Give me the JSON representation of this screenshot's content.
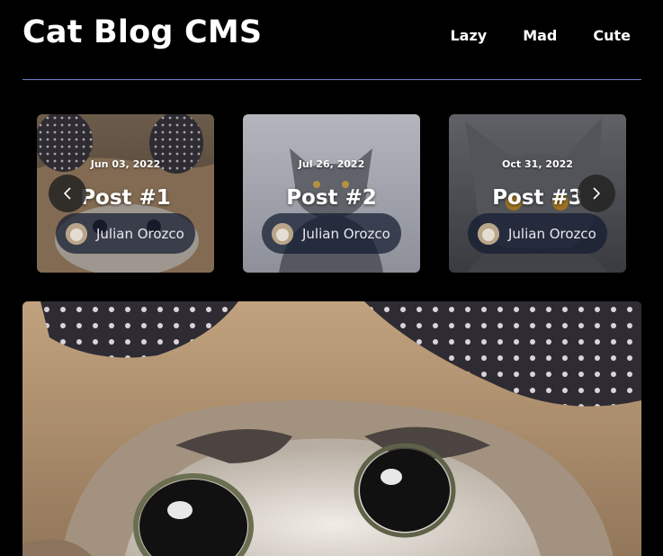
{
  "site": {
    "title": "Cat Blog CMS"
  },
  "nav": {
    "items": [
      {
        "label": "Lazy"
      },
      {
        "label": "Mad"
      },
      {
        "label": "Cute"
      }
    ]
  },
  "carousel": {
    "posts": [
      {
        "date": "Jun 03, 2022",
        "title": "Post #1",
        "author": "Julian Orozco"
      },
      {
        "date": "Jul 26, 2022",
        "title": "Post #2",
        "author": "Julian Orozco"
      },
      {
        "date": "Oct 31, 2022",
        "title": "Post #3",
        "author": "Julian Orozco"
      }
    ],
    "prev_icon": "chevron-left-icon",
    "next_icon": "chevron-right-icon"
  },
  "colors": {
    "background": "#000000",
    "divider": "#6f7fcf",
    "pill": "#141c30"
  }
}
